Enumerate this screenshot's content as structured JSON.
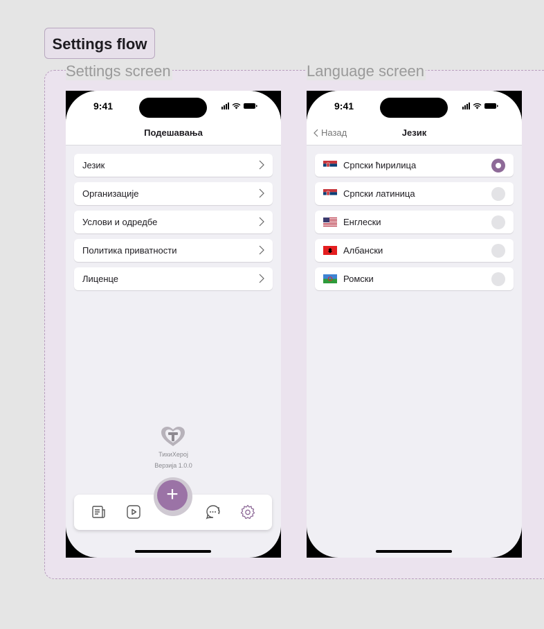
{
  "flow_title": "Settings flow",
  "settings_screen": {
    "label": "Settings screen",
    "time": "9:41",
    "title": "Подешавања",
    "items": [
      {
        "label": "Језик"
      },
      {
        "label": "Организације"
      },
      {
        "label": "Услови и одредбе"
      },
      {
        "label": "Политика приватности"
      },
      {
        "label": "Лиценце"
      }
    ],
    "app_name": "ТихиХерој",
    "version": "Верзија 1.0.0",
    "tabs": [
      "news-icon",
      "video-icon",
      "chat-icon",
      "settings-icon"
    ],
    "fab_label": "+"
  },
  "language_screen": {
    "label": "Language screen",
    "time": "9:41",
    "back_label": "Назад",
    "title": "Језик",
    "languages": [
      {
        "label": "Српски ћирилица",
        "flag": "serbia-flag-icon",
        "selected": true
      },
      {
        "label": "Српски латиница",
        "flag": "serbia-flag-icon",
        "selected": false
      },
      {
        "label": "Енглески",
        "flag": "usa-flag-icon",
        "selected": false
      },
      {
        "label": "Албански",
        "flag": "albania-flag-icon",
        "selected": false
      },
      {
        "label": "Ромски",
        "flag": "romani-flag-icon",
        "selected": false
      }
    ]
  },
  "colors": {
    "accent": "#9b73a6",
    "radio_selected": "#8e6a98",
    "radio_unselected": "#e3e3e6",
    "section_bg": "#ebe3ee"
  }
}
